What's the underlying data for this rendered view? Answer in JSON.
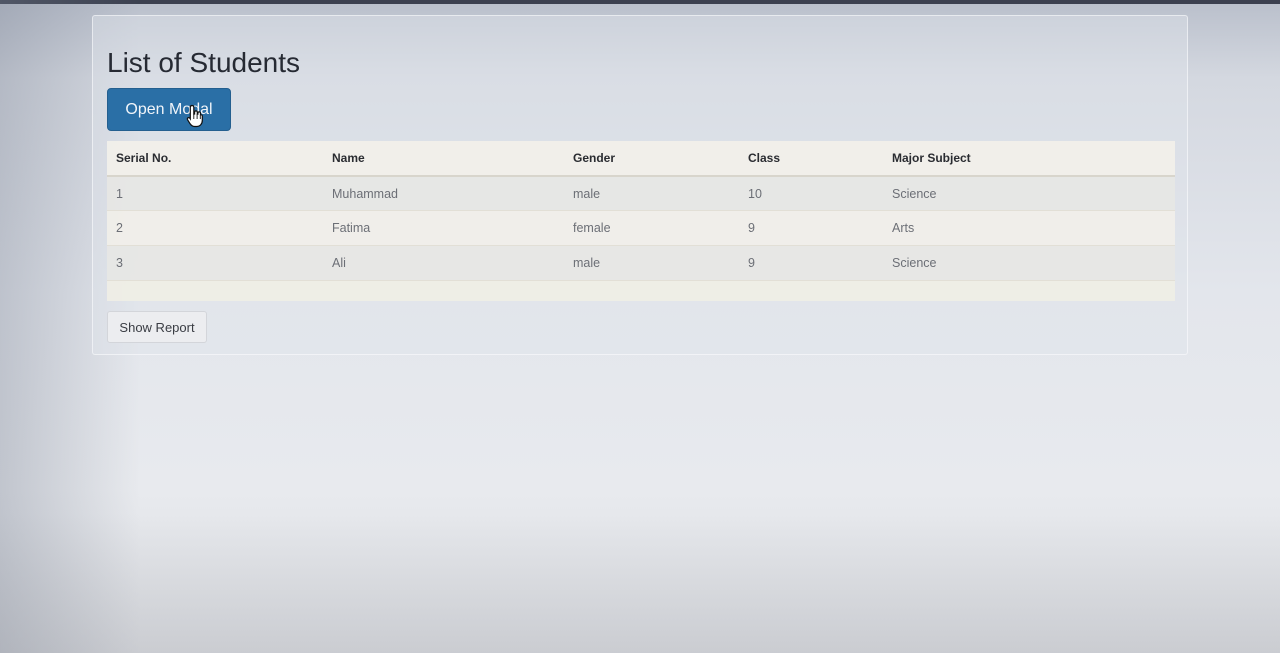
{
  "page": {
    "title": "List of Students"
  },
  "actions": {
    "open_modal_label": "Open Modal",
    "show_report_label": "Show Report"
  },
  "table": {
    "headers": [
      "Serial No.",
      "Name",
      "Gender",
      "Class",
      "Major Subject"
    ],
    "rows": [
      [
        "1",
        "Muhammad",
        "male",
        "10",
        "Science"
      ],
      [
        "2",
        "Fatima",
        "female",
        "9",
        "Arts"
      ],
      [
        "3",
        "Ali",
        "male",
        "9",
        "Science"
      ]
    ]
  },
  "icons": {
    "cursor": "hand-pointer-icon"
  },
  "colors": {
    "primary_button": "#2a6fa6",
    "title_text": "#262a33"
  }
}
